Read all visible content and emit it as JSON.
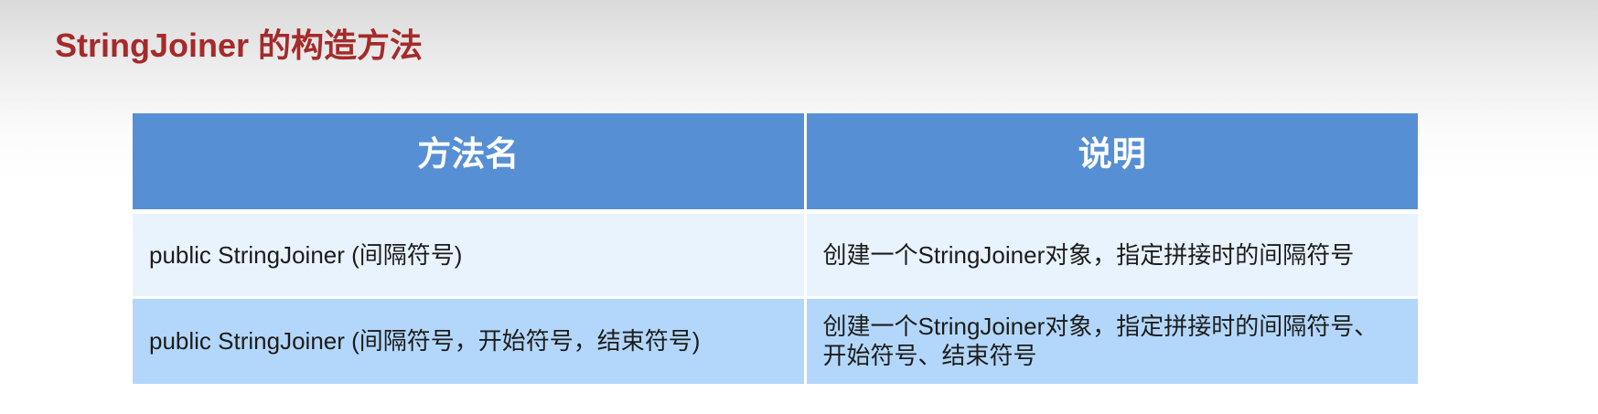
{
  "title": "StringJoiner 的构造方法",
  "table": {
    "headers": [
      "方法名",
      "说明"
    ],
    "rows": [
      {
        "method": "public StringJoiner (间隔符号)",
        "description": "创建一个StringJoiner对象，指定拼接时的间隔符号"
      },
      {
        "method": "public StringJoiner (间隔符号，开始符号，结束符号)",
        "description": "创建一个StringJoiner对象，指定拼接时的间隔符号、开始符号、结束符号"
      }
    ]
  },
  "colors": {
    "title": "#a52a2a",
    "header_bg": "#578fd4",
    "row_light_bg": "#e9f3fd",
    "row_blue_bg": "#b3d7fa"
  }
}
